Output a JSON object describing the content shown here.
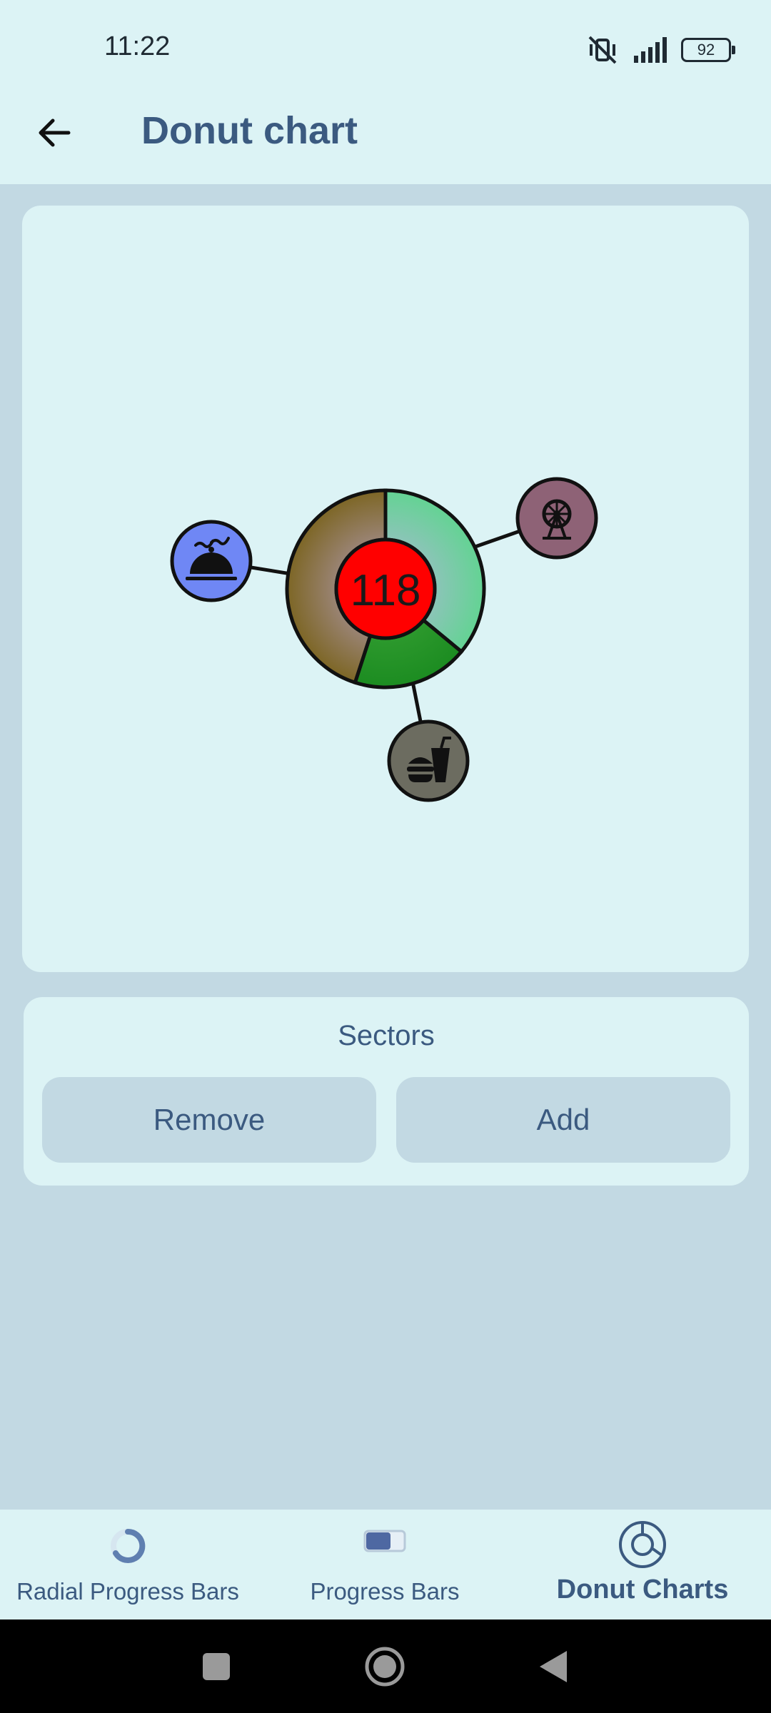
{
  "status_bar": {
    "time": "11:22",
    "battery": "92"
  },
  "app_bar": {
    "title": "Donut chart"
  },
  "chart_data": {
    "type": "pie",
    "variant": "donut",
    "center_label": "118",
    "center_color": "#ff0000",
    "sectors": [
      {
        "icon": "ferris-wheel-icon",
        "icon_color": "#8e6276",
        "fraction": 0.36,
        "color": "#63d393"
      },
      {
        "icon": "fast-food-icon",
        "icon_color": "#6c6c60",
        "fraction": 0.19,
        "color": "#1c8c21"
      },
      {
        "icon": "room-service-icon",
        "icon_color": "#6f87f5",
        "fraction": 0.45,
        "color": "#7d6625"
      }
    ]
  },
  "sectors_panel": {
    "title": "Sectors",
    "remove_label": "Remove",
    "add_label": "Add"
  },
  "bottom_nav": {
    "items": [
      {
        "label": "Radial Progress Bars",
        "icon": "radial-progress-icon",
        "active": false
      },
      {
        "label": "Progress Bars",
        "icon": "progress-bar-icon",
        "active": false
      },
      {
        "label": "Donut Charts",
        "icon": "donut-chart-icon",
        "active": true
      }
    ]
  },
  "colors": {
    "background": "#c2d9e3",
    "surface": "#dcf3f5",
    "accent": "#3b5a80"
  }
}
